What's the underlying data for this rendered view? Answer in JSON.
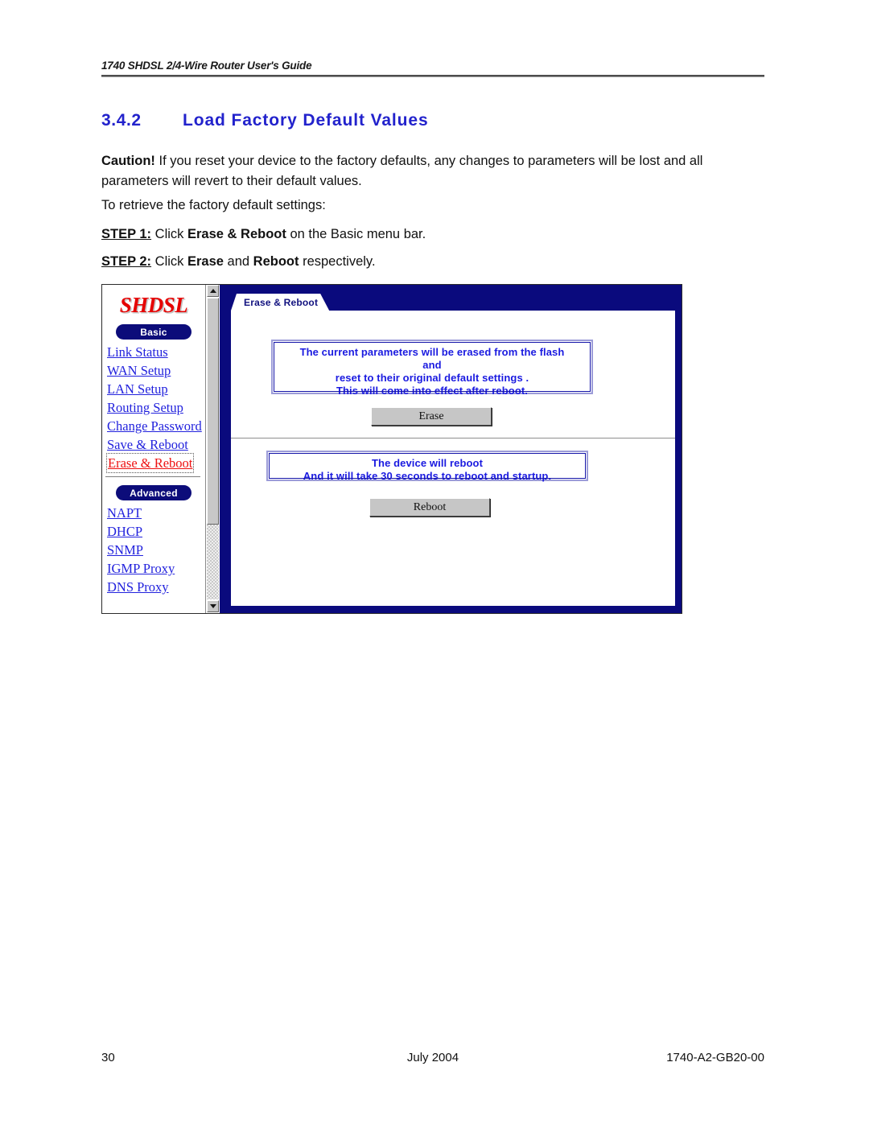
{
  "page": {
    "running_header": "1740 SHDSL 2/4-Wire Router User's Guide",
    "section_number": "3.4.2",
    "section_title": "Load Factory Default Values",
    "paragraphs": {
      "caution_label": "Caution!",
      "caution_text": " If you reset your device to the factory defaults, any changes to parameters will be lost and all parameters will revert to their default values.",
      "retrieve": "To retrieve the factory default settings:",
      "step1_label": "STEP 1:",
      "step1_pre": " Click ",
      "step1_bold": "Erase & Reboot",
      "step1_post": " on the Basic menu bar.",
      "step2_label": "STEP 2:",
      "step2_pre": " Click ",
      "step2_bold1": "Erase",
      "step2_mid": " and ",
      "step2_bold2": "Reboot",
      "step2_post": " respectively."
    },
    "footer": {
      "page_number": "30",
      "date": "July 2004",
      "doc_number": "1740-A2-GB20-00"
    }
  },
  "screenshot": {
    "nav": {
      "logo": "SHDSL",
      "basic_pill": "Basic",
      "basic_items": [
        {
          "label": "Link Status",
          "active": false
        },
        {
          "label": "WAN Setup",
          "active": false
        },
        {
          "label": "LAN Setup",
          "active": false
        },
        {
          "label": "Routing Setup",
          "active": false
        },
        {
          "label": "Change Password",
          "active": false
        },
        {
          "label": "Save & Reboot",
          "active": false
        },
        {
          "label": "Erase & Reboot",
          "active": true
        }
      ],
      "advanced_pill": "Advanced",
      "advanced_items": [
        {
          "label": "NAPT"
        },
        {
          "label": "DHCP"
        },
        {
          "label": "SNMP"
        },
        {
          "label": "IGMP Proxy"
        },
        {
          "label": "DNS Proxy"
        }
      ]
    },
    "scrollbar": {
      "up_arrow": "scroll-up-arrow-icon",
      "down_arrow": "scroll-down-arrow-icon"
    },
    "tab_label": "Erase & Reboot",
    "erase_section": {
      "message_line1": "The current parameters will be erased from the flash",
      "message_line2": "and",
      "message_line3": "reset to their original default settings .",
      "message_line4": "This will come into effect after reboot.",
      "button_label": "Erase"
    },
    "reboot_section": {
      "message_line1": "The device will reboot",
      "message_line2": "And it will take 30 seconds to reboot and startup.",
      "button_label": "Reboot"
    },
    "colors": {
      "frame_navy": "#0a0a7d",
      "link_blue": "#2222dd",
      "active_link_red": "#ee1111",
      "logo_red": "#e60000",
      "message_blue": "#1a1ae0",
      "heading_blue": "#2222cc"
    }
  }
}
